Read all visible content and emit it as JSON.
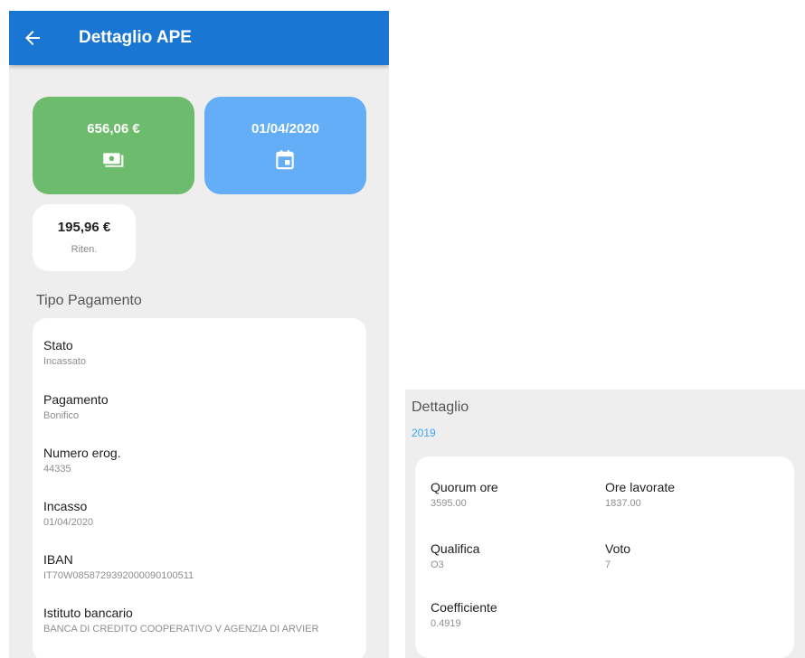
{
  "header": {
    "title": "Dettaglio APE"
  },
  "summary": {
    "amount": "656,06 €",
    "date": "01/04/2020",
    "ritenuta_value": "195,96 €",
    "ritenuta_label": "Riten."
  },
  "payment_section": {
    "title": "Tipo Pagamento",
    "fields": [
      {
        "label": "Stato",
        "value": "Incassato"
      },
      {
        "label": "Pagamento",
        "value": "Bonifico"
      },
      {
        "label": "Numero erog.",
        "value": "44335"
      },
      {
        "label": "Incasso",
        "value": "01/04/2020"
      },
      {
        "label": "IBAN",
        "value": "IT70W0858729392000090100511"
      },
      {
        "label": "Istituto bancario",
        "value": "BANCA DI CREDITO COOPERATIVO V AGENZIA DI ARVIER"
      }
    ]
  },
  "detail_section": {
    "title": "Dettaglio",
    "year": "2019",
    "fields": [
      {
        "label": "Quorum ore",
        "value": "3595.00"
      },
      {
        "label": "Ore lavorate",
        "value": "1837.00"
      },
      {
        "label": "Qualifica",
        "value": "O3"
      },
      {
        "label": "Voto",
        "value": "7"
      },
      {
        "label": "Coefficiente",
        "value": "0.4919"
      }
    ]
  },
  "colors": {
    "appbar": "#1976d2",
    "amount_tile": "#6dbb6d",
    "date_tile": "#63aef6",
    "year_accent": "#42a5f5"
  },
  "icons": {
    "back": "arrow-left",
    "amount": "money-icon",
    "date": "calendar-icon"
  }
}
